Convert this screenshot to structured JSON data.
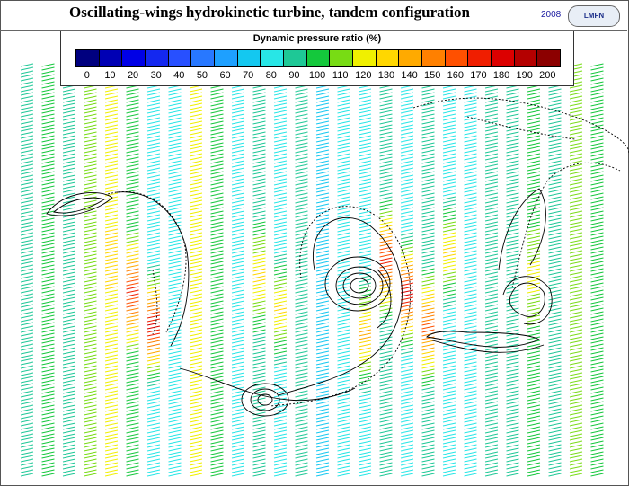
{
  "header": {
    "title": "Oscillating-wings hydrokinetic turbine, tandem configuration",
    "year": "2008",
    "logo_text": "LMFN"
  },
  "legend": {
    "title": "Dynamic pressure ratio (%)",
    "ticks": [
      "0",
      "10",
      "20",
      "30",
      "40",
      "50",
      "60",
      "70",
      "80",
      "90",
      "100",
      "110",
      "120",
      "130",
      "140",
      "150",
      "160",
      "170",
      "180",
      "190",
      "200"
    ],
    "colors": [
      "#00007f",
      "#0000b4",
      "#0000e6",
      "#1428f0",
      "#2850ff",
      "#2878ff",
      "#1ea0ff",
      "#14c8f0",
      "#28e6e6",
      "#1ec896",
      "#14c83c",
      "#78dc14",
      "#f0f000",
      "#ffd700",
      "#ffaa00",
      "#ff8000",
      "#ff5000",
      "#f01e00",
      "#dc0000",
      "#b40000",
      "#8c0000"
    ]
  },
  "diagram": {
    "column_levels": [
      9,
      10,
      9,
      11,
      12,
      10,
      8,
      8,
      12,
      10,
      8,
      9,
      8,
      9,
      7,
      8,
      8,
      9,
      8,
      9,
      8,
      8,
      9,
      9,
      10,
      9,
      11,
      10
    ],
    "hot_zones": [
      {
        "column": 4,
        "level": 13
      },
      {
        "column": 5,
        "level": 17
      },
      {
        "column": 6,
        "level": 18
      },
      {
        "column": 11,
        "level": 13
      },
      {
        "column": 12,
        "level": 13
      },
      {
        "column": 16,
        "level": 14
      },
      {
        "column": 17,
        "level": 17
      },
      {
        "column": 18,
        "level": 18
      },
      {
        "column": 19,
        "level": 16
      },
      {
        "column": 20,
        "level": 13
      },
      {
        "column": 24,
        "level": 12
      }
    ],
    "vortex_cores": [
      {
        "label": "vortex-upper",
        "column": 15
      },
      {
        "label": "vortex-lower",
        "column": 11
      }
    ]
  }
}
